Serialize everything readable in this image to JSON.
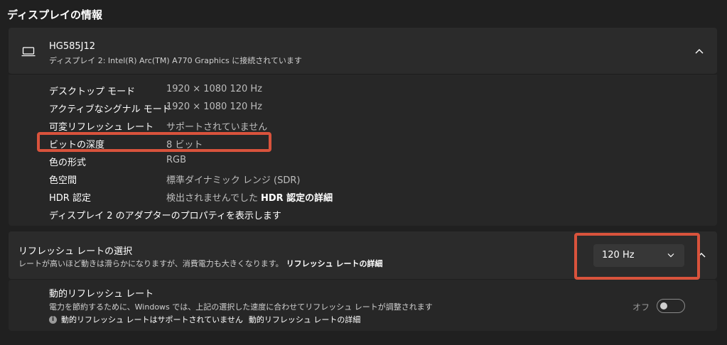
{
  "page": {
    "title": "ディスプレイの情報"
  },
  "monitor": {
    "name": "HG585J12",
    "subtitle": "ディスプレイ 2: Intel(R) Arc(TM) A770 Graphics に接続されています",
    "icon": "laptop-icon"
  },
  "details": [
    {
      "label": "デスクトップ モード",
      "value": "1920 × 1080 120 Hz"
    },
    {
      "label": "アクティブなシグナル モード",
      "value": "1920 × 1080 120 Hz"
    },
    {
      "label": "可変リフレッシュ レート",
      "value": "サポートされていません"
    },
    {
      "label": "ビットの深度",
      "value": "8 ビット"
    },
    {
      "label": "色の形式",
      "value": "RGB"
    },
    {
      "label": "色空間",
      "value": "標準ダイナミック レンジ (SDR)"
    },
    {
      "label": "HDR 認定",
      "value": "検出されませんでした",
      "link": "HDR 認定の詳細"
    }
  ],
  "adapter_link": "ディスプレイ 2 のアダプターのプロパティを表示します",
  "refresh": {
    "title": "リフレッシュ レートの選択",
    "description": "レートが高いほど動きは滑らかになりますが、消費電力も大きくなります。",
    "link": "リフレッシュ レートの詳細",
    "selected": "120 Hz"
  },
  "dynamic": {
    "title": "動的リフレッシュ レート",
    "description": "電力を節約するために、Windows では、上記の選択した速度に合わせてリフレッシュ レートが調整されます",
    "note": "動的リフレッシュ レートはサポートされていません",
    "note_link": "動的リフレッシュ レートの詳細",
    "toggle_label": "オフ",
    "toggle_on": false
  },
  "colors": {
    "highlight": "#d9533c",
    "background": "#202020",
    "card": "#2b2b2b"
  }
}
